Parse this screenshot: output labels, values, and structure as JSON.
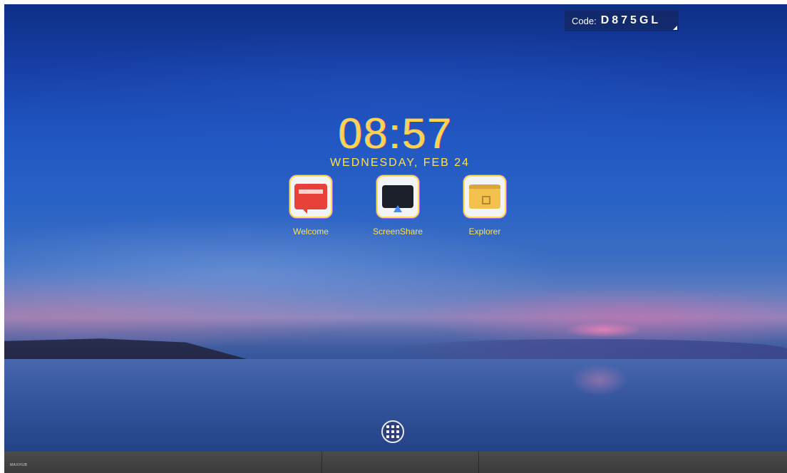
{
  "status": {
    "code_label": "Code:",
    "code_value": "D875GL"
  },
  "clock": {
    "time": "08:57",
    "date": "WEDNESDAY, FEB 24"
  },
  "apps": [
    {
      "label": "Welcome",
      "icon": "welcome-icon"
    },
    {
      "label": "ScreenShare",
      "icon": "screenshare-icon"
    },
    {
      "label": "Explorer",
      "icon": "folder-icon"
    }
  ],
  "launcher": {
    "icon": "app-grid-icon"
  },
  "taskbar": {
    "brand": "MAXHUB"
  },
  "colors": {
    "clock_yellow": "#ffd34d",
    "badge_bg": "#14234f",
    "sky_top": "#0e2f86",
    "taskbar": "#444444"
  }
}
